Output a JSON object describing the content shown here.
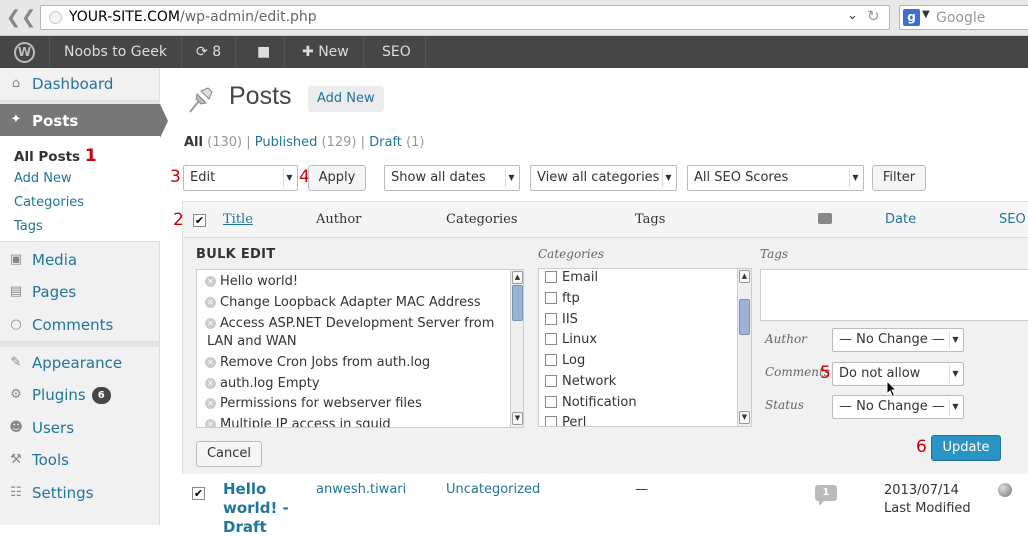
{
  "browser": {
    "url_host": "YOUR-SITE.COM",
    "url_path": "/wp-admin/edit.php",
    "search_placeholder": "Google",
    "search_engine_icon": "google-icon",
    "back_icon": "back-arrow-icon",
    "reload_icon": "reload-icon"
  },
  "adminbar": {
    "logo_icon": "wordpress-logo-icon",
    "site_name": "Noobs to Geek",
    "updates_count": "8",
    "comments_icon": "comment-bubble-icon",
    "new_label": "New",
    "seo_label": "SEO"
  },
  "sidebar": {
    "dashboard": "Dashboard",
    "posts": "Posts",
    "submenu": {
      "all_posts": "All Posts",
      "add_new": "Add New",
      "categories": "Categories",
      "tags": "Tags"
    },
    "media": "Media",
    "pages": "Pages",
    "comments": "Comments",
    "appearance": "Appearance",
    "plugins": "Plugins",
    "plugins_badge": "6",
    "users": "Users",
    "tools": "Tools",
    "settings": "Settings"
  },
  "annotations": {
    "n1": "1",
    "n2": "2",
    "n3": "3",
    "n4": "4",
    "n5": "5",
    "n6": "6"
  },
  "main": {
    "title": "Posts",
    "add_new": "Add New",
    "filters": {
      "all": "All",
      "all_count": "(130)",
      "published": "Published",
      "published_count": "(129)",
      "draft": "Draft",
      "draft_count": "(1)",
      "separator": "|"
    },
    "bulk_action": "Edit",
    "apply": "Apply",
    "dates": "Show all dates",
    "categories_filter": "View all categories",
    "seo_scores": "All SEO Scores",
    "filter_button": "Filter"
  },
  "table": {
    "headers": {
      "title": "Title",
      "author": "Author",
      "categories": "Categories",
      "tags": "Tags",
      "comments_icon": "comment-icon",
      "date": "Date",
      "seo": "SEO"
    }
  },
  "bulk_edit": {
    "heading": "BULK EDIT",
    "titles": [
      "Hello world!",
      "Change Loopback Adapter MAC Address",
      "Access ASP.NET Development Server from",
      "LAN and WAN",
      "Remove Cron Jobs from auth.log",
      "auth.log Empty",
      "Permissions for webserver files",
      "Multiple IP access in squid"
    ],
    "categories_label": "Categories",
    "categories": [
      "Email",
      "ftp",
      "IIS",
      "Linux",
      "Log",
      "Network",
      "Notification",
      "Perl"
    ],
    "tags_label": "Tags",
    "author_label": "Author",
    "author_value": "— No Change —",
    "comments_label": "Comments",
    "comments_value": "Do not allow",
    "status_label": "Status",
    "status_value": "— No Change —",
    "cancel": "Cancel",
    "update": "Update"
  },
  "row": {
    "title_line1": "Hello",
    "title_line2": "world! -",
    "title_line3": "Draft",
    "author": "anwesh.tiwari",
    "categories": "Uncategorized",
    "tags": "—",
    "comments": "1",
    "date": "2013/07/14",
    "date_status": "Last Modified"
  }
}
